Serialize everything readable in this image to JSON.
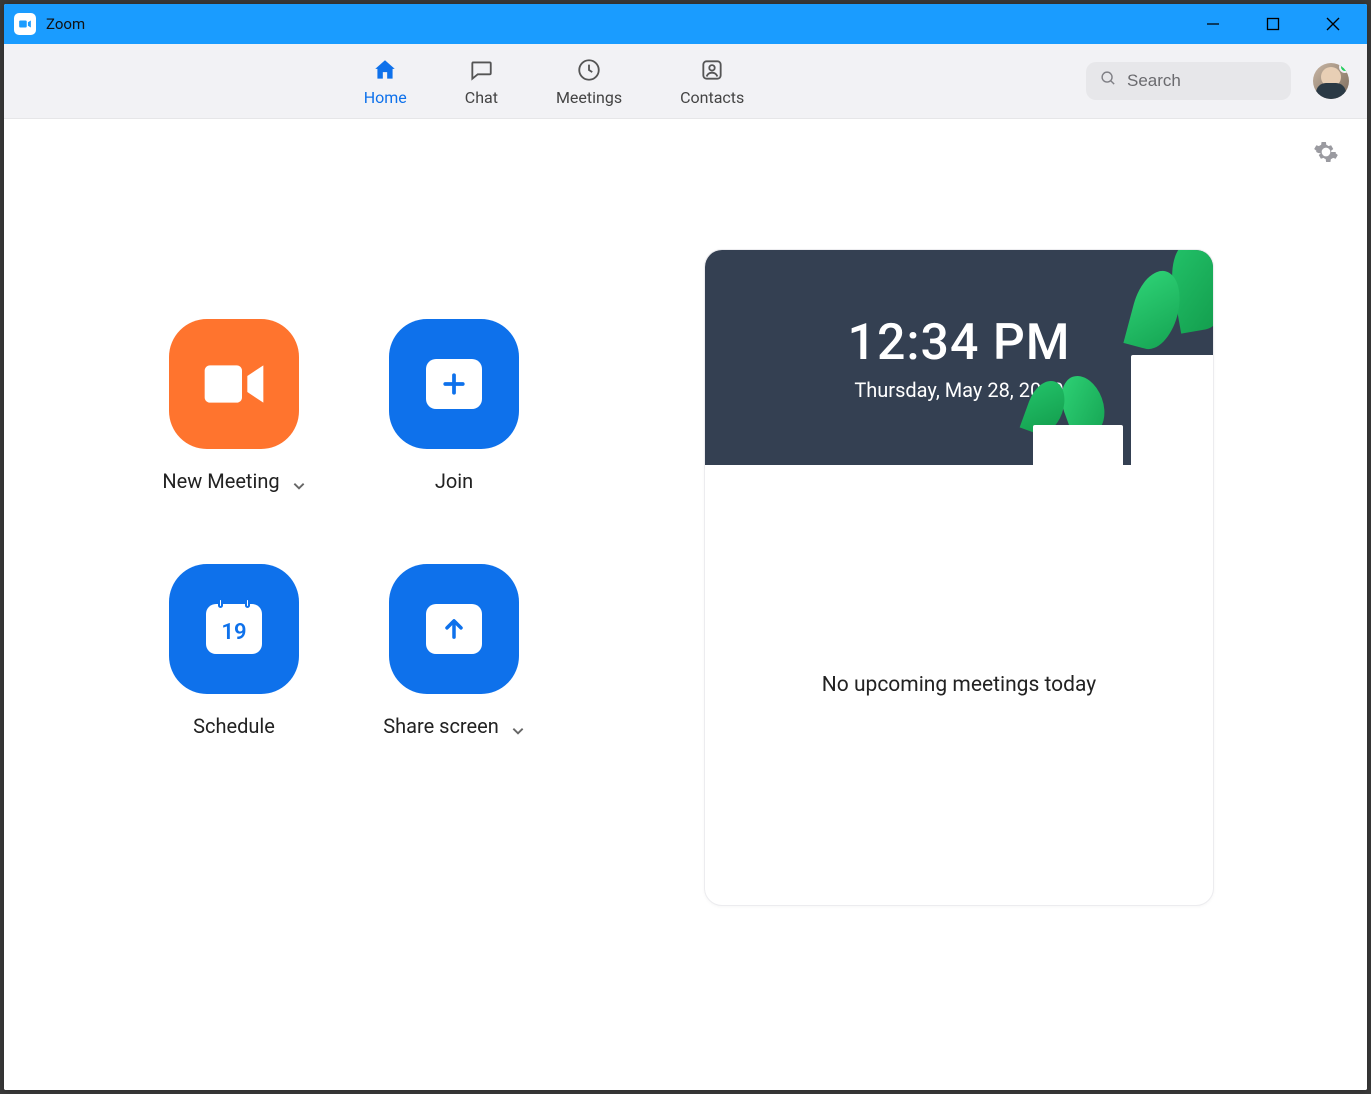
{
  "window": {
    "title": "Zoom"
  },
  "nav": {
    "home": "Home",
    "chat": "Chat",
    "meetings": "Meetings",
    "contacts": "Contacts"
  },
  "search": {
    "placeholder": "Search"
  },
  "actions": {
    "new_meeting": "New Meeting",
    "join": "Join",
    "schedule": "Schedule",
    "schedule_day": "19",
    "share_screen": "Share screen"
  },
  "clock": {
    "time": "12:34 PM",
    "date": "Thursday, May 28, 2020"
  },
  "upcoming": {
    "empty_text": "No upcoming meetings today"
  },
  "colors": {
    "accent_blue": "#0e71eb",
    "accent_orange": "#ff742e",
    "titlebar": "#1a9cff"
  }
}
